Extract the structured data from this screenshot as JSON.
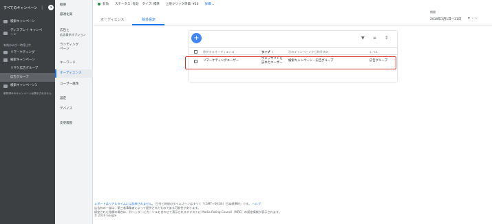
{
  "sidebar": {
    "header": "すべてのキャンペーン",
    "items": [
      {
        "label": "検索キャンペーン",
        "icon": "search-campaign-icon",
        "kind": "row"
      },
      {
        "label": "ディスプレイ キャンペーン",
        "icon": "display-campaign-icon",
        "kind": "row2"
      },
      {
        "label": "有効および一時停止中",
        "kind": "section"
      },
      {
        "label": "リマーケティング",
        "icon": "campaign-icon",
        "kind": "row"
      },
      {
        "label": "検索キャンペーン",
        "icon": "campaign-icon",
        "kind": "row"
      },
      {
        "label": "リマケ広告グループ",
        "kind": "sub"
      },
      {
        "label": "広告グループ",
        "kind": "sub-sel"
      },
      {
        "label": "検索キャンペーン1",
        "icon": "campaign-icon",
        "kind": "row"
      },
      {
        "label": "削除済みのキャンペーンは表示されません",
        "kind": "section"
      }
    ]
  },
  "nav": {
    "items": [
      "概要",
      "最適化案",
      "広告と",
      "広告表示オプション",
      "ランディング",
      "ページ",
      "キーワード",
      "オーディエンス",
      "ユーザー属性",
      "設定",
      "デバイス",
      "変更履歴"
    ]
  },
  "topbar": {
    "status": "有効",
    "status_label": "ステータス: 有効",
    "type_label": "タイプ: 標準",
    "bid_label": "上限クリック単価: ¥20",
    "details": "詳細"
  },
  "tabs": {
    "audience": "オーディエンス",
    "exclusion": "除外設定"
  },
  "period": {
    "label": "期間",
    "value": "2019年3月1日～31日"
  },
  "table": {
    "headers": {
      "excluded_audience": "除外するオーディエンス",
      "type": "タイプ",
      "level_info": "次のキャンペーンから除外済み",
      "level": "レベル"
    },
    "rows": [
      {
        "audience": "リマーケティングユーザー",
        "type_line1": "ウェブサイトを",
        "type_line2": "訪れたユーザー",
        "campaign_link": "検索キャンペーン",
        "campaign_rest": " › 広告グループ",
        "level": "広告グループ"
      }
    ]
  },
  "footer": {
    "line1_link": "レポートはリアルタイムには反映されません。",
    "line1_text": "日付と時刻のタイムゾーンはすべて「（GMT+09:00）日本標準時」です。",
    "line1_help": "ヘルプ",
    "line2": "広告枠の一部は、第三者事業者によって提供されたものである可能性があります。",
    "line3": "認定された指標の場合は、列ヘッダーにカーソルを合わせて表示されるテキストに Media Rating Council（MRC）の認定情報が表示されます。",
    "line4": "© 2019 Google"
  },
  "colors": {
    "accent": "#1a73e8",
    "fab": "#4285f4",
    "highlight": "#d93025",
    "status_green": "#1e8e3e"
  }
}
